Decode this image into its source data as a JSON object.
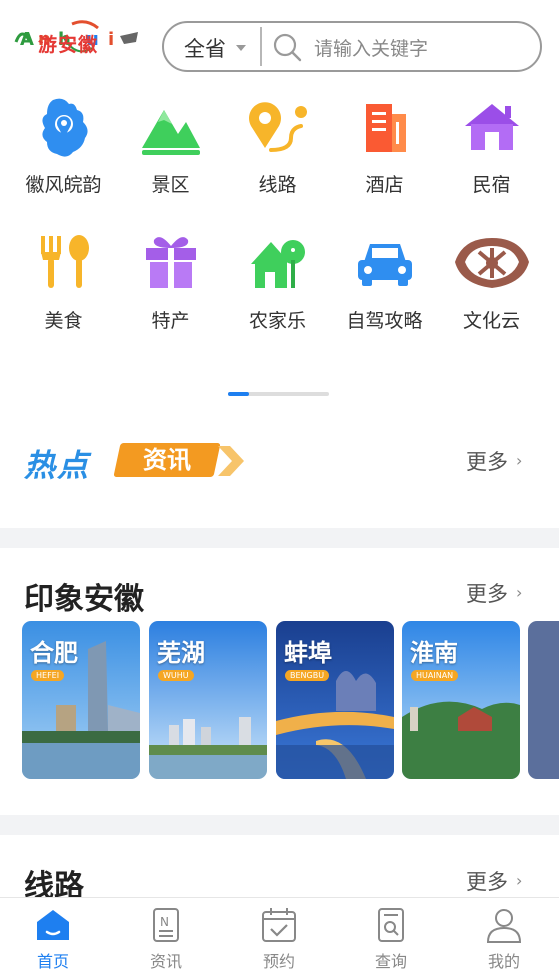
{
  "header": {
    "logo_text": [
      "A",
      "n",
      "h",
      "u",
      "i"
    ],
    "logo_sub": "游安徽",
    "region": "全省",
    "search_placeholder": "请输入关键字"
  },
  "categories": [
    {
      "label": "徽风皖韵",
      "icon": "anhui-map-icon"
    },
    {
      "label": "景区",
      "icon": "mountain-icon"
    },
    {
      "label": "线路",
      "icon": "route-icon"
    },
    {
      "label": "酒店",
      "icon": "hotel-icon"
    },
    {
      "label": "民宿",
      "icon": "house-icon"
    },
    {
      "label": "美食",
      "icon": "fork-spoon-icon"
    },
    {
      "label": "特产",
      "icon": "gift-icon"
    },
    {
      "label": "农家乐",
      "icon": "farmhouse-icon"
    },
    {
      "label": "自驾攻略",
      "icon": "car-icon"
    },
    {
      "label": "文化云",
      "icon": "culture-cloud-icon"
    }
  ],
  "pager": {
    "pages": 2,
    "active": 1
  },
  "hot_news": {
    "title_a": "热点",
    "title_b": "资讯",
    "more": "更多"
  },
  "impression": {
    "title": "印象安徽",
    "more": "更多",
    "cities": [
      {
        "name": "合肥",
        "pinyin": "HEFEI"
      },
      {
        "name": "芜湖",
        "pinyin": "WUHU"
      },
      {
        "name": "蚌埠",
        "pinyin": "BENGBU"
      },
      {
        "name": "淮南",
        "pinyin": "HUAINAN"
      }
    ]
  },
  "routes": {
    "title": "线路",
    "more": "更多"
  },
  "tabbar": [
    {
      "label": "首页",
      "icon": "home-icon",
      "active": true
    },
    {
      "label": "资讯",
      "icon": "news-icon",
      "active": false
    },
    {
      "label": "预约",
      "icon": "calendar-check-icon",
      "active": false
    },
    {
      "label": "查询",
      "icon": "search-doc-icon",
      "active": false
    },
    {
      "label": "我的",
      "icon": "user-icon",
      "active": false
    }
  ],
  "colors": {
    "accent": "#1e7ff0",
    "hot_orange": "#f39a21",
    "hot_blue": "#2a8fe4"
  }
}
